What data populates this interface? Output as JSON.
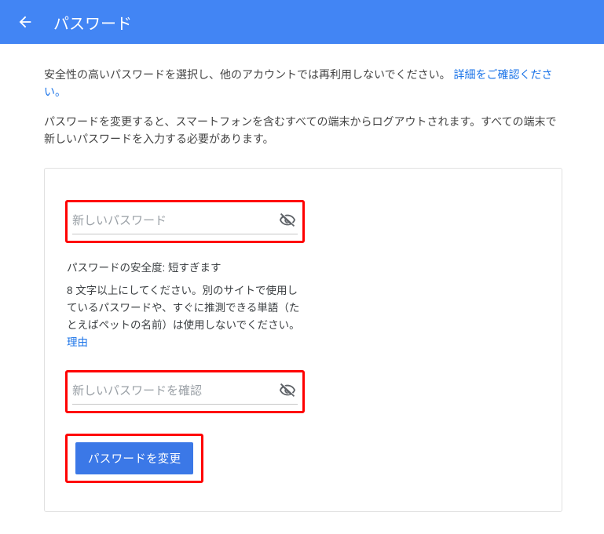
{
  "header": {
    "title": "パスワード"
  },
  "intro": {
    "line1_a": "安全性の高いパスワードを選択し、他のアカウントでは再利用しないでください。",
    "learn_more": "詳細をご確認ください。",
    "line2": "パスワードを変更すると、スマートフォンを含むすべての端末からログアウトされます。すべての端末で新しいパスワードを入力する必要があります。"
  },
  "form": {
    "new_password_placeholder": "新しいパスワード",
    "confirm_password_placeholder": "新しいパスワードを確認",
    "strength_label": "パスワードの安全度:",
    "strength_value": "短すぎます",
    "hint_text": "8 文字以上にしてください。別のサイトで使用しているパスワードや、すぐに推測できる単語（たとえばペットの名前）は使用しないでください。",
    "hint_link": "理由",
    "submit_label": "パスワードを変更"
  }
}
